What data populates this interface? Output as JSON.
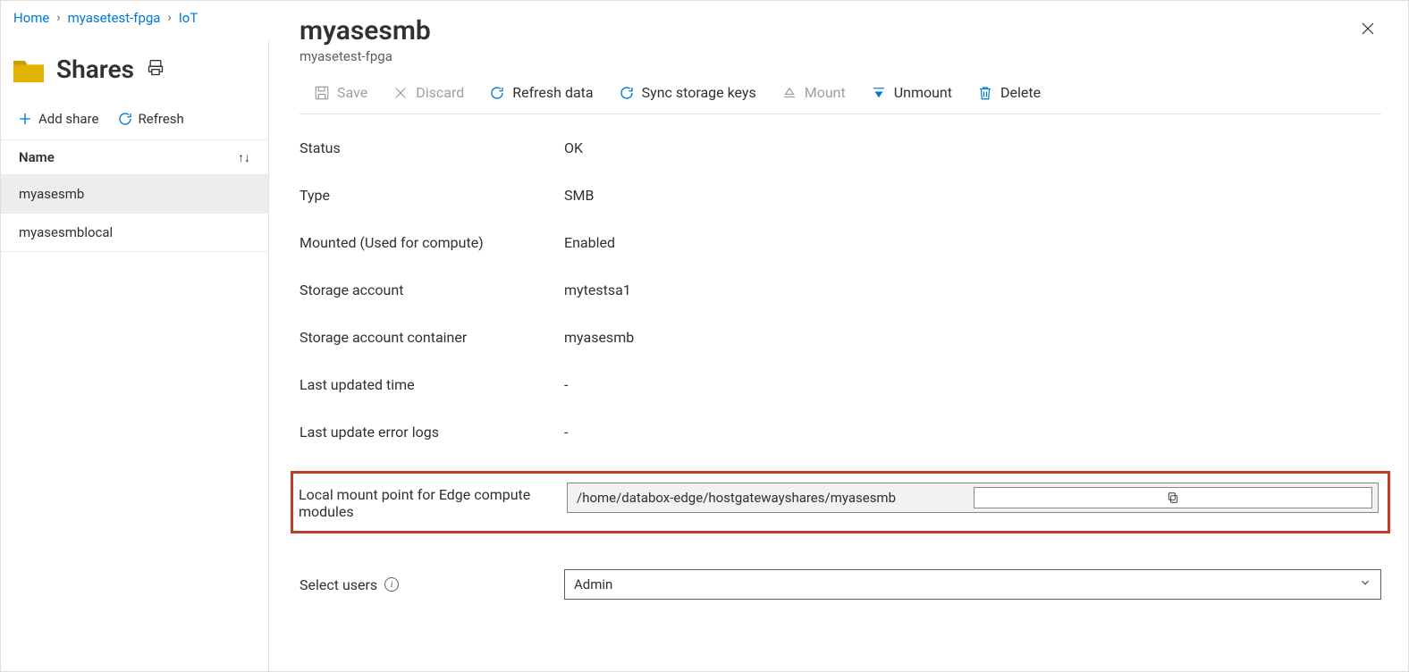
{
  "breadcrumb": {
    "home": "Home",
    "parent": "myasetest-fpga",
    "current_trunc": "IoT"
  },
  "left": {
    "title": "Shares",
    "add_label": "Add share",
    "refresh_label": "Refresh",
    "list_header": "Name",
    "items": [
      {
        "label": "myasesmb",
        "selected": true
      },
      {
        "label": "myasesmblocal",
        "selected": false
      }
    ]
  },
  "detail": {
    "title": "myasesmb",
    "subtitle": "myasetest-fpga",
    "toolbar": {
      "save": "Save",
      "discard": "Discard",
      "refresh_data": "Refresh data",
      "sync_keys": "Sync storage keys",
      "mount": "Mount",
      "unmount": "Unmount",
      "delete": "Delete"
    },
    "props": {
      "status_label": "Status",
      "status_value": "OK",
      "type_label": "Type",
      "type_value": "SMB",
      "mounted_label": "Mounted (Used for compute)",
      "mounted_value": "Enabled",
      "storage_acct_label": "Storage account",
      "storage_acct_value": "mytestsa1",
      "container_label": "Storage account container",
      "container_value": "myasesmb",
      "updated_time_label": "Last updated time",
      "updated_time_value": "-",
      "error_logs_label": "Last update error logs",
      "error_logs_value": "-",
      "mount_point_label": "Local mount point for Edge compute modules",
      "mount_point_value": "/home/databox-edge/hostgatewayshares/myasesmb",
      "select_users_label": "Select users",
      "select_users_value": "Admin"
    }
  }
}
